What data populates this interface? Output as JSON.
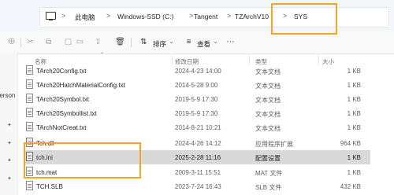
{
  "address": {
    "crumbs": [
      "此电脑",
      "Windows-SSD (C:)",
      "Tangent",
      "TZArchV10",
      "SYS"
    ],
    "separator": ">"
  },
  "toolbar": {
    "sort_label": "排序",
    "view_label": "查看"
  },
  "nav": {
    "partial_label": "Person"
  },
  "columns": {
    "name": "名称",
    "date": "修改日期",
    "type": "类型",
    "size": "大小"
  },
  "files": [
    {
      "name": "TArch20Config.txt",
      "date": "2024-4-23 14:00",
      "type": "文本文档",
      "size": "1 KB",
      "icon": "text-file-icon"
    },
    {
      "name": "TArch20HatchMaterialConfig.txt",
      "date": "2014-5-28 9:00",
      "type": "文本文档",
      "size": "1 KB",
      "icon": "text-file-icon"
    },
    {
      "name": "TArch20Symbol.txt",
      "date": "2019-5-9 17:30",
      "type": "文本文档",
      "size": "1 KB",
      "icon": "text-file-icon"
    },
    {
      "name": "TArch20Symbollist.txt",
      "date": "2019-5-9 17:30",
      "type": "文本文档",
      "size": "1 KB",
      "icon": "text-file-icon"
    },
    {
      "name": "TArchNotCreat.txt",
      "date": "2014-8-21 10:21",
      "type": "文本文档",
      "size": "1 KB",
      "icon": "text-file-icon"
    },
    {
      "name": "Tch.dll",
      "date": "2024-4-26 14:12",
      "type": "应用程序扩展",
      "size": "964 KB",
      "icon": "dll-file-icon"
    },
    {
      "name": "tch.ini",
      "date": "2025-2-28 11:16",
      "type": "配置设置",
      "size": "1 KB",
      "icon": "ini-file-icon"
    },
    {
      "name": "tch.mat",
      "date": "2009-3-11 15:51",
      "type": "MAT 文件",
      "size": "1 KB",
      "icon": "generic-file-icon"
    },
    {
      "name": "TCH.SLB",
      "date": "2023-7-24 16:43",
      "type": "SLB 文件",
      "size": "432 KB",
      "icon": "generic-file-icon"
    }
  ],
  "selected_file": "tch.ini",
  "colors": {
    "highlight": "#f5a623",
    "selected_row": "#d9d9d9"
  }
}
